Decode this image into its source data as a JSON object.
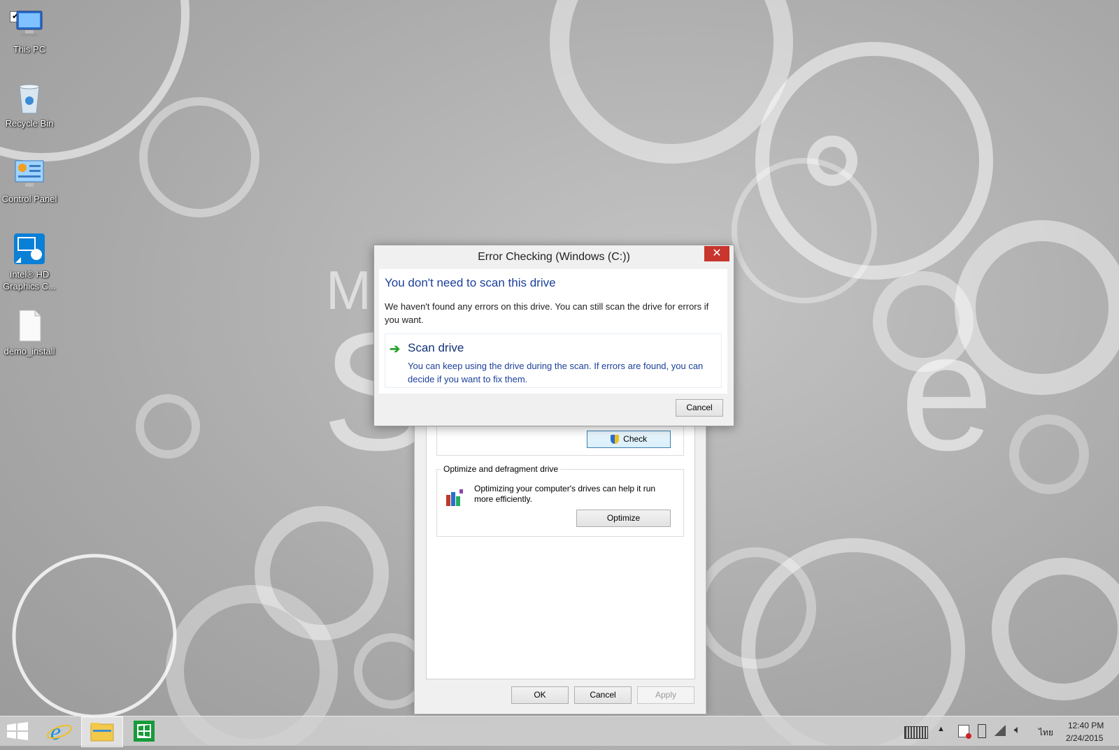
{
  "desktop": {
    "icons": [
      {
        "label": "This PC"
      },
      {
        "label": "Recycle Bin"
      },
      {
        "label": "Control Panel"
      },
      {
        "label": "Intel® HD Graphics C..."
      },
      {
        "label": "demo_install"
      }
    ],
    "wallpaper_text_top": "Mi",
    "wallpaper_text_big": "S          e"
  },
  "properties_window": {
    "error_group_button": "Check",
    "optimize_group": {
      "title": "Optimize and defragment drive",
      "description": "Optimizing your computer's drives can help it run more efficiently.",
      "button": "Optimize"
    },
    "footer": {
      "ok": "OK",
      "cancel": "Cancel",
      "apply": "Apply"
    }
  },
  "error_dialog": {
    "title": "Error Checking (Windows (C:))",
    "close_glyph": "✕",
    "heading": "You don't need to scan this drive",
    "message": "We haven't found any errors on this drive. You can still scan the drive for errors if you want.",
    "command": {
      "title": "Scan drive",
      "description": "You can keep using the drive during the scan. If errors are found, you can decide if you want to fix them."
    },
    "cancel": "Cancel"
  },
  "taskbar": {
    "pinned": [
      "start-button",
      "internet-explorer-icon",
      "file-explorer-icon",
      "store-icon"
    ],
    "tray": {
      "language": "ไทย",
      "time": "12:40 PM",
      "date": "2/24/2015"
    }
  },
  "colors": {
    "close_button": "#c7352c",
    "heading_blue": "#1b3f9a",
    "arrow_green": "#2aa32a"
  }
}
